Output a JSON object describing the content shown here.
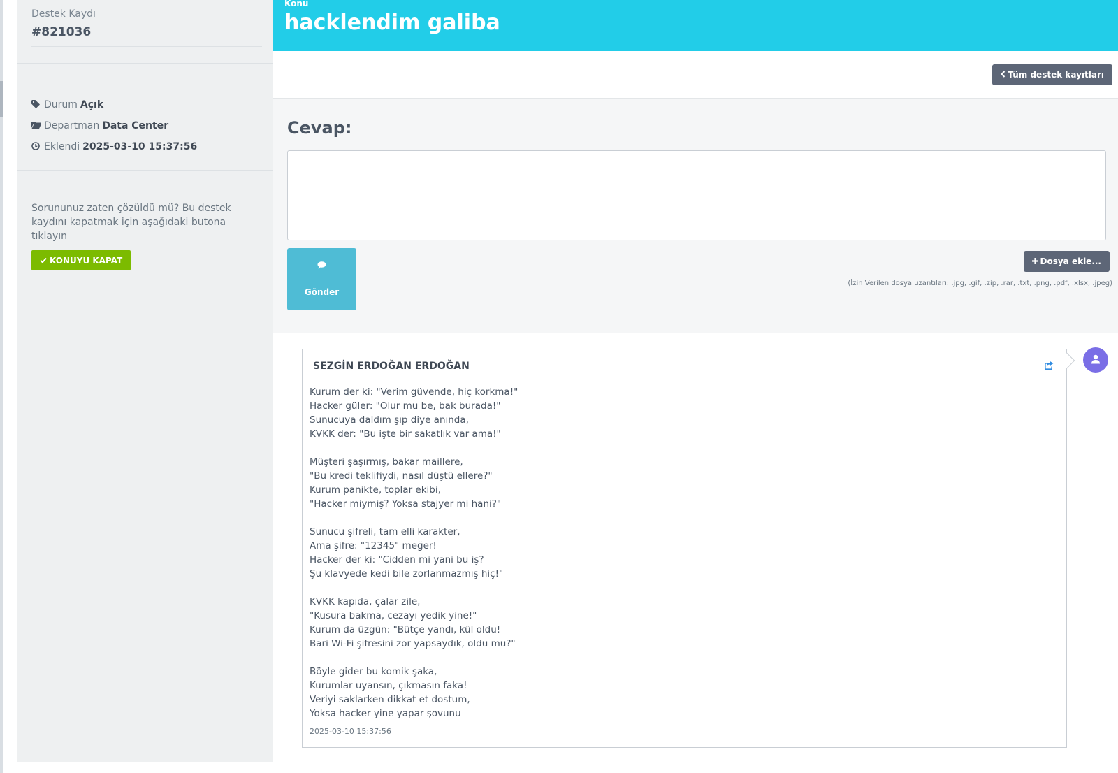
{
  "sidebar": {
    "ticket_label": "Destek Kaydı",
    "ticket_id": "#821036",
    "status_label": "Durum",
    "status_value": "Açık",
    "department_label": "Departman",
    "department_value": "Data Center",
    "added_label": "Eklendi",
    "added_value": "2025-03-10 15:37:56",
    "close_text": "Sorununuz zaten çözüldü mü? Bu destek kaydını kapatmak için aşağıdaki butona tıklayın",
    "close_button": "KONUYU KAPAT"
  },
  "header": {
    "label": "Konu",
    "title": "hacklendim galiba"
  },
  "toolbar": {
    "all_tickets_button": "Tüm destek kayıtları"
  },
  "reply": {
    "title": "Cevap:",
    "text_value": "",
    "send_button": "Gönder",
    "add_file_button": "Dosya ekle...",
    "file_note": "(İzin Verilen dosya uzantıları: .jpg, .gif, .zip, .rar, .txt, .png, .pdf, .xlsx, .jpeg)"
  },
  "message": {
    "author": "SEZGİN ERDOĞAN ERDOĞAN",
    "paragraphs": [
      [
        "Kurum der ki: \"Verim güvende, hiç korkma!\"",
        "Hacker güler: \"Olur mu be, bak burada!\"",
        "Sunucuya daldım şıp diye anında,",
        "KVKK der: \"Bu işte bir sakatlık var ama!\""
      ],
      [
        "Müşteri şaşırmış, bakar maillere,",
        "\"Bu kredi teklifiydi, nasıl düştü ellere?\"",
        "Kurum panikte, toplar ekibi,",
        "\"Hacker miymiş? Yoksa stajyer mi hani?\""
      ],
      [
        "Sunucu şifreli, tam elli karakter,",
        "Ama şifre: \"12345\" meğer!",
        "Hacker der ki: \"Cidden mi yani bu iş?",
        "Şu klavyede kedi bile zorlanmazmış hiç!\""
      ],
      [
        "KVKK kapıda, çalar zile,",
        "\"Kusura bakma, cezayı yedik yine!\"",
        "Kurum da üzgün: \"Bütçe yandı, kül oldu!",
        "Bari Wi-Fi şifresini zor yapsaydık, oldu mu?\""
      ],
      [
        "Böyle gider bu komik şaka,",
        "Kurumlar uyansın, çıkmasın faka!",
        "Veriyi saklarken dikkat et dostum,",
        "Yoksa hacker yine yapar şovunu"
      ]
    ],
    "date": "2025-03-10 15:37:56"
  },
  "icons": {
    "status": "tag-icon",
    "department": "folder-icon",
    "added": "clock-icon",
    "close": "check-icon",
    "back": "chevron-left-icon",
    "send": "comment-icon",
    "file": "plus-icon",
    "share": "share-icon",
    "avatar": "user-icon"
  },
  "colors": {
    "header": "#22cde8",
    "close_button": "#7cbb00",
    "send_button": "#4fbcd5",
    "dark_button": "#5d6677",
    "avatar": "#7a6ee6"
  }
}
